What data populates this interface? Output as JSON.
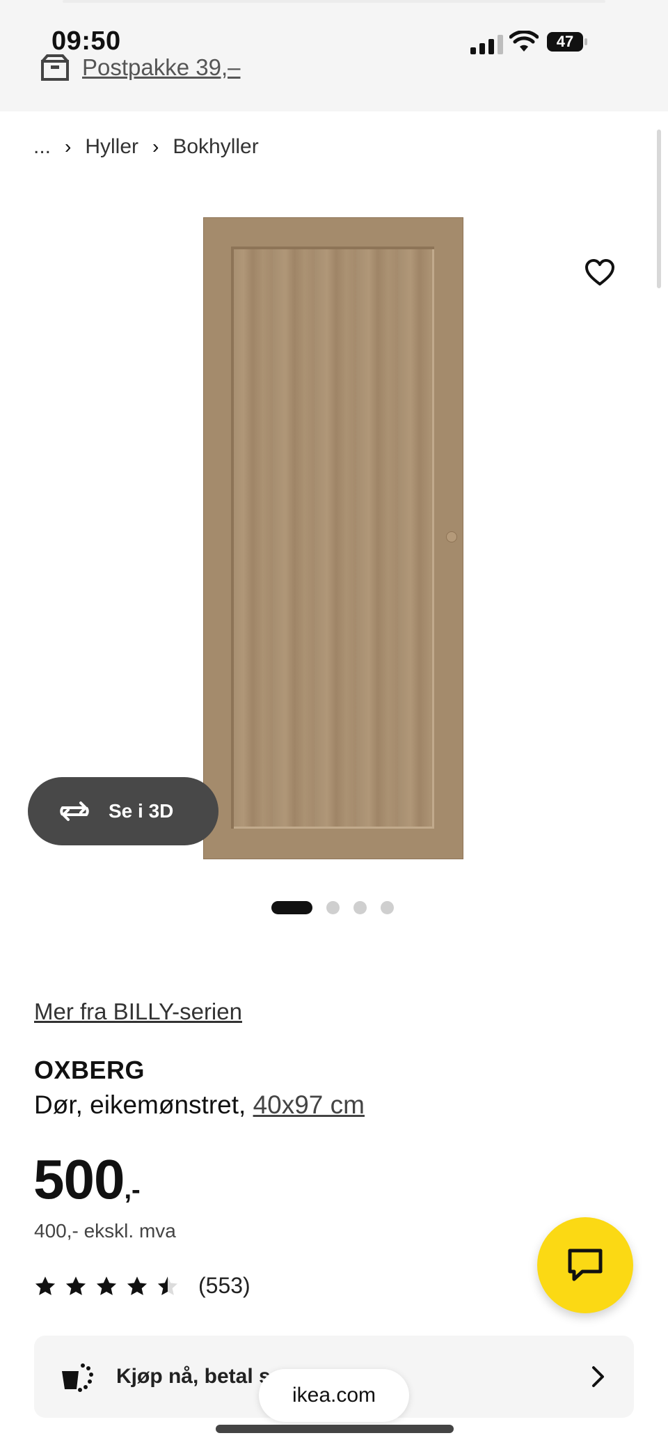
{
  "status_bar": {
    "time": "09:50",
    "battery": "47"
  },
  "promo": {
    "text": "Postpakke 39,–"
  },
  "breadcrumb": {
    "items": [
      "...",
      "Hyller",
      "Bokhyller"
    ]
  },
  "gallery": {
    "button_3d": "Se i 3D",
    "dots_count": 4,
    "active_index": 0
  },
  "product": {
    "series_link": "Mer fra BILLY-serien",
    "name": "OXBERG",
    "description": "Dør, eikemønstret,",
    "size": "40x97 cm",
    "price_int": "500",
    "price_suffix": ",-",
    "price_ex_vat": "400,- ekskl. mva",
    "rating": 4.5,
    "review_count": "(553)"
  },
  "pay_later": {
    "label": "Kjøp nå, betal s"
  },
  "browser": {
    "domain": "ikea.com"
  },
  "colors": {
    "accent": "#fbd914",
    "dark_button": "#484848"
  }
}
